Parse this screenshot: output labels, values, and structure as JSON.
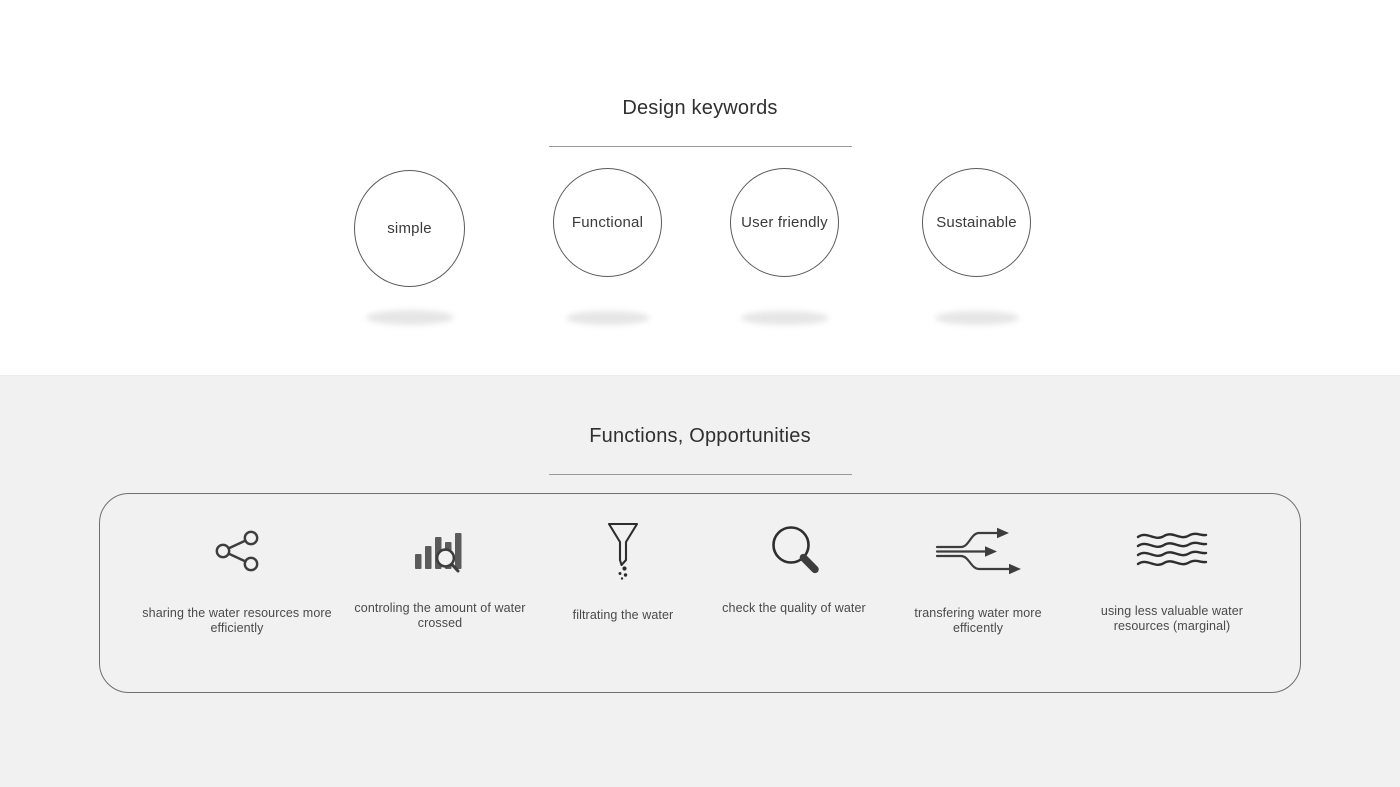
{
  "sections": {
    "keywords": {
      "title": "Design keywords",
      "items": [
        {
          "label": "simple"
        },
        {
          "label": "Functional"
        },
        {
          "label": "User friendly"
        },
        {
          "label": "Sustainable"
        }
      ]
    },
    "functions": {
      "title": "Functions, Opportunities",
      "items": [
        {
          "icon": "share-nodes-icon",
          "caption": "sharing the water resources more efficiently"
        },
        {
          "icon": "bar-chart-search-icon",
          "caption": "controling the amount of water crossed"
        },
        {
          "icon": "funnel-drip-icon",
          "caption": "filtrating the water"
        },
        {
          "icon": "magnifier-icon",
          "caption": "check the quality of water"
        },
        {
          "icon": "flow-arrows-icon",
          "caption": "transfering water more efficently"
        },
        {
          "icon": "waves-icon",
          "caption": "using less valuable water resources (marginal)"
        }
      ]
    }
  },
  "colors": {
    "page_background": "#ffffff",
    "panel_background": "#f1f1f1",
    "stroke": "#3d3d3d",
    "rule": "#9a9a9a",
    "circle_border": "#5a5a5a",
    "panel_border": "#6f6f6f",
    "text": "#3d3d3d",
    "shadow": "#e6e6e6"
  }
}
